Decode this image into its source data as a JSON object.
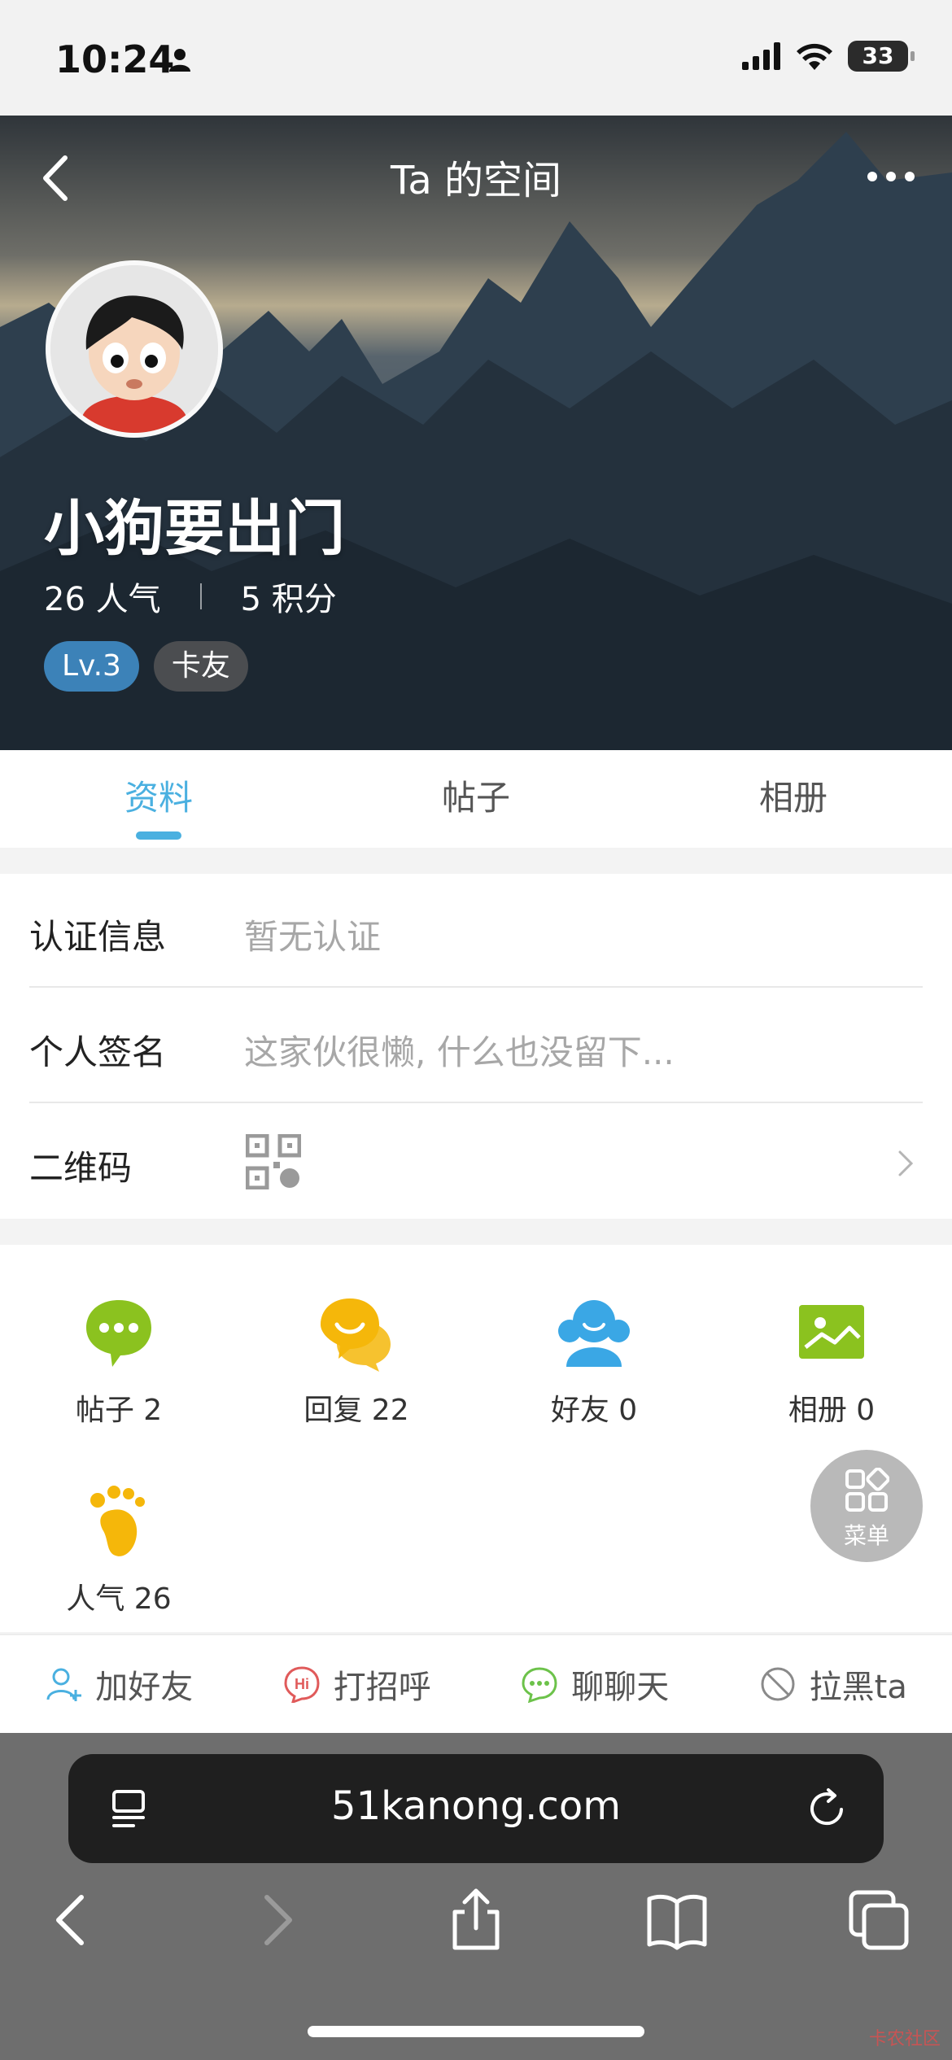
{
  "status_bar": {
    "time": "10:24",
    "battery": "33"
  },
  "header": {
    "title": "Ta 的空间"
  },
  "profile": {
    "username": "小狗要出门",
    "popularity": "26 人气",
    "points": "5 积分",
    "level_badge": "Lv.3",
    "role_badge": "卡友"
  },
  "tabs": [
    {
      "label": "资料",
      "active": true
    },
    {
      "label": "帖子",
      "active": false
    },
    {
      "label": "相册",
      "active": false
    }
  ],
  "info": {
    "certification": {
      "label": "认证信息",
      "value": "暂无认证"
    },
    "signature": {
      "label": "个人签名",
      "value": "这家伙很懒, 什么也没留下..."
    },
    "qrcode": {
      "label": "二维码"
    }
  },
  "stats_grid": [
    {
      "label": "帖子 2",
      "icon": "chat-bubble-icon",
      "color": "#8bc21f"
    },
    {
      "label": "回复 22",
      "icon": "reply-bubbles-icon",
      "color": "#f5b70a"
    },
    {
      "label": "好友 0",
      "icon": "friends-icon",
      "color": "#3aa7e5"
    },
    {
      "label": "相册 0",
      "icon": "album-icon",
      "color": "#8bc21f"
    },
    {
      "label": "人气 26",
      "icon": "footprint-icon",
      "color": "#f5b70a"
    }
  ],
  "menu_fab": {
    "label": "菜单"
  },
  "actions": [
    {
      "label": "加好友",
      "icon": "add-friend-icon",
      "color": "#4ab0e0"
    },
    {
      "label": "打招呼",
      "icon": "hi-icon",
      "color": "#e05a5a"
    },
    {
      "label": "聊聊天",
      "icon": "chat-icon",
      "color": "#6cc24a"
    },
    {
      "label": "拉黑ta",
      "icon": "block-icon",
      "color": "#8a8a8a"
    }
  ],
  "browser": {
    "url": "51kanong.com"
  },
  "watermark": "卡农社区"
}
